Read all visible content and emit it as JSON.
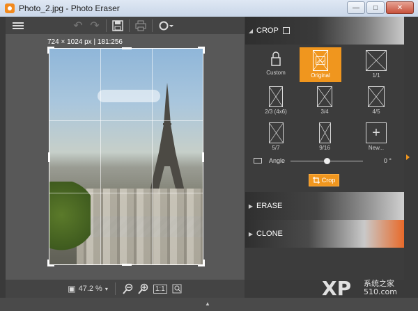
{
  "window": {
    "title": "Photo_2.jpg - Photo Eraser",
    "min": "—",
    "max": "□",
    "close": "✕"
  },
  "toolbar": {
    "menu": "menu-icon",
    "undo": "↶",
    "redo": "↷",
    "save": "💾",
    "print": "🖶",
    "rotate": "⟳"
  },
  "canvas": {
    "dims": "724 × 1024 px | 181:256"
  },
  "zoom": {
    "icon": "▣",
    "value": "47.2 %",
    "caret": "▾",
    "zoom_out": "−",
    "zoom_in": "+",
    "actual": "1:1",
    "fit": "⤢"
  },
  "panel": {
    "crop": {
      "title": "CROP",
      "arrow": "◢"
    },
    "erase": {
      "title": "ERASE",
      "arrow": "▶"
    },
    "clone": {
      "title": "CLONE",
      "arrow": "▶"
    },
    "ratios": [
      {
        "label": "Custom"
      },
      {
        "label": "Original"
      },
      {
        "label": "1/1"
      },
      {
        "label": "2/3 (4x6)"
      },
      {
        "label": "3/4"
      },
      {
        "label": "4/5"
      },
      {
        "label": "5/7"
      },
      {
        "label": "9/16"
      },
      {
        "label": "New..."
      }
    ],
    "angle_label": "Angle",
    "angle_value": "0 °",
    "crop_button": "Crop"
  },
  "watermark": {
    "text": "XP",
    "sub": "系统之家\n510.com"
  },
  "colors": {
    "accent": "#f0961e",
    "panel": "#3c3c3c",
    "canvas": "#585858"
  }
}
